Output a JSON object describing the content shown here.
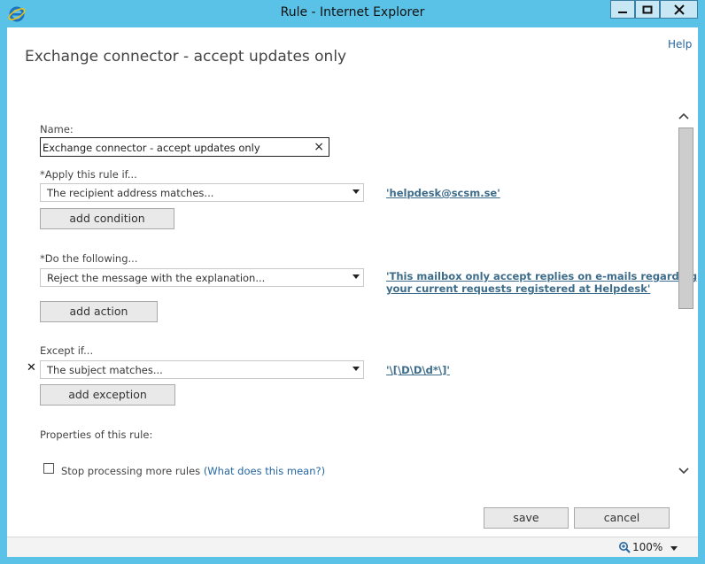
{
  "window": {
    "title": "Rule - Internet Explorer"
  },
  "header": {
    "help": "Help",
    "page_title": "Exchange connector - accept updates only"
  },
  "form": {
    "name_label": "Name:",
    "name_value": "Exchange connector - accept updates only",
    "apply_label": "*Apply this rule if...",
    "apply_select": "The recipient address matches...",
    "apply_value": "'helpdesk@scsm.se'",
    "add_condition": "add condition",
    "do_label": "*Do the following...",
    "do_select": "Reject the message with the explanation...",
    "do_value_line1": "'This mailbox only accept replies on e-mails regarding",
    "do_value_line2": "your current requests registered at Helpdesk'",
    "add_action": "add action",
    "except_label": "Except if...",
    "except_select": "The subject matches...",
    "except_value": "'\\[\\D\\D\\d*\\]'",
    "add_exception": "add exception",
    "properties_label": "Properties of this rule:",
    "stop_processing": "Stop processing more rules",
    "what_does": "(What does this mean?)"
  },
  "footer": {
    "save": "save",
    "cancel": "cancel"
  },
  "statusbar": {
    "zoom": "100%"
  },
  "icons": {
    "browser": "internet-explorer-icon",
    "minimize": "minimize-icon",
    "maximize": "maximize-icon",
    "close": "close-icon",
    "clear": "clear-icon",
    "remove": "remove-icon",
    "zoom": "zoom-icon"
  }
}
